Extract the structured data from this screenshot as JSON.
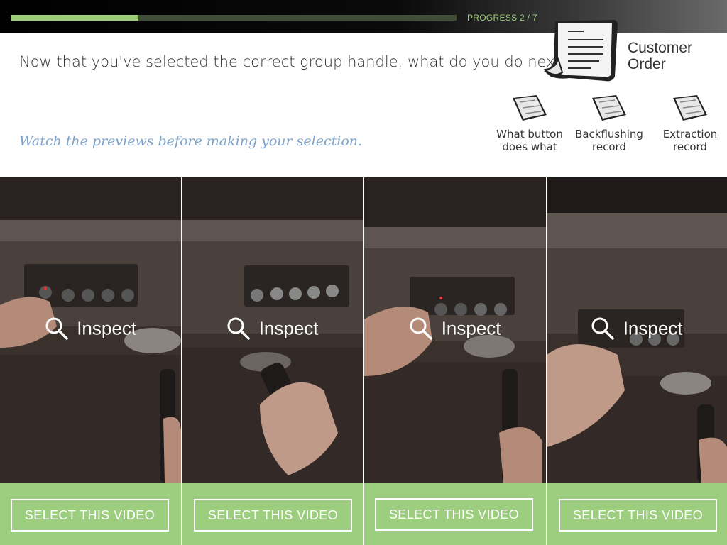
{
  "progress": {
    "label": "PROGRESS 2 / 7",
    "current": 2,
    "total": 7,
    "fraction": 0.286
  },
  "question": "Now that you've selected the correct group handle, what do you do next?",
  "hint": "Watch the previews before making your selection.",
  "customer_order": {
    "label_line1": "Customer",
    "label_line2": "Order",
    "icon": "receipt-icon"
  },
  "docs": [
    {
      "label": "What button does what",
      "icon": "document-icon"
    },
    {
      "label": "Backflushing record",
      "icon": "document-icon"
    },
    {
      "label": "Extraction record",
      "icon": "document-icon"
    }
  ],
  "videos": [
    {
      "inspect_label": "Inspect",
      "select_label": "SELECT THIS VIDEO",
      "icon": "magnifier-icon"
    },
    {
      "inspect_label": "Inspect",
      "select_label": "SELECT THIS VIDEO",
      "icon": "magnifier-icon"
    },
    {
      "inspect_label": "Inspect",
      "select_label": "SELECT THIS VIDEO",
      "icon": "magnifier-icon"
    },
    {
      "inspect_label": "Inspect",
      "select_label": "SELECT THIS VIDEO",
      "icon": "magnifier-icon"
    }
  ],
  "colors": {
    "accent_green": "#9dcd7e",
    "hint_blue": "#7da3cc",
    "text_dark": "#333333"
  }
}
